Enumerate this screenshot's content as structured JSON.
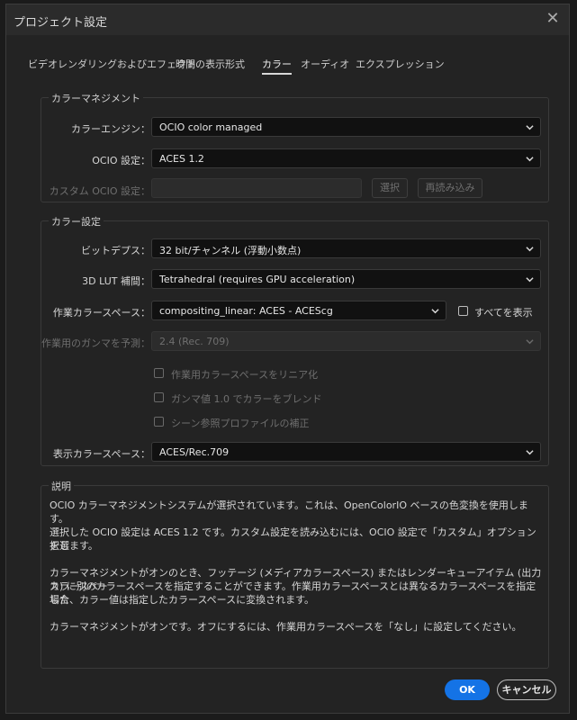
{
  "dialog": {
    "title": "プロジェクト設定"
  },
  "tabs": [
    {
      "label": "ビデオレンダリングおよびエフェクト"
    },
    {
      "label": "時間の表示形式"
    },
    {
      "label": "カラー",
      "active": true
    },
    {
      "label": "オーディオ"
    },
    {
      "label": "エクスプレッション"
    }
  ],
  "color_management": {
    "title": "カラーマネジメント",
    "engine_label": "カラーエンジン：",
    "engine_value": "OCIO color managed",
    "ocio_label": "OCIO 設定：",
    "ocio_value": "ACES 1.2",
    "custom_label": "カスタム OCIO 設定：",
    "select_button": "選択",
    "reload_button": "再読み込み"
  },
  "color_settings": {
    "title": "カラー設定",
    "bit_depth_label": "ビットデプス：",
    "bit_depth_value": "32 bit/チャンネル (浮動小数点)",
    "lut_label": "3D LUT 補間：",
    "lut_value": "Tetrahedral (requires GPU acceleration)",
    "working_space_label": "作業カラースペース：",
    "working_space_value": "compositing_linear: ACES - ACEScg",
    "show_all_label": "すべてを表示",
    "gamma_label": "作業用のガンマを予測：",
    "gamma_value": "2.4 (Rec. 709)",
    "linearize_label": "作業用カラースペースをリニア化",
    "blend_gamma_label": "ガンマ値 1.0 でカラーをブレンド",
    "scene_profile_label": "シーン参照プロファイルの補正",
    "display_space_label": "表示カラースペース：",
    "display_space_value": "ACES/Rec.709"
  },
  "description": {
    "title": "説明",
    "p1": "OCIO カラーマネジメントシステムが選択されています。これは、OpenColorIO ベースの色変換を使用します。",
    "p2_line1": "選択した OCIO 設定は ACES 1.2 です。カスタム設定を読み込むには、OCIO 設定で「カスタム」オプションを選",
    "p2_line2": "択します。",
    "p3_line1": "カラーマネジメントがオンのとき、フッテージ (メディアカラースペース) またはレンダーキューアイテム (出力カラースペー",
    "p3_line2": "ス) に別のカラースペースを指定することができます。作業用カラースペースとは異なるカラースペースを指定した",
    "p3_line3": "場合、カラー値は指定したカラースペースに変換されます。",
    "p4": "カラーマネジメントがオンです。オフにするには、作業用カラースペースを「なし」に設定してください。"
  },
  "buttons": {
    "ok": "OK",
    "cancel": "キャンセル"
  },
  "colors": {
    "accent": "#1473e6",
    "background": "#232323",
    "field": "#111111"
  }
}
